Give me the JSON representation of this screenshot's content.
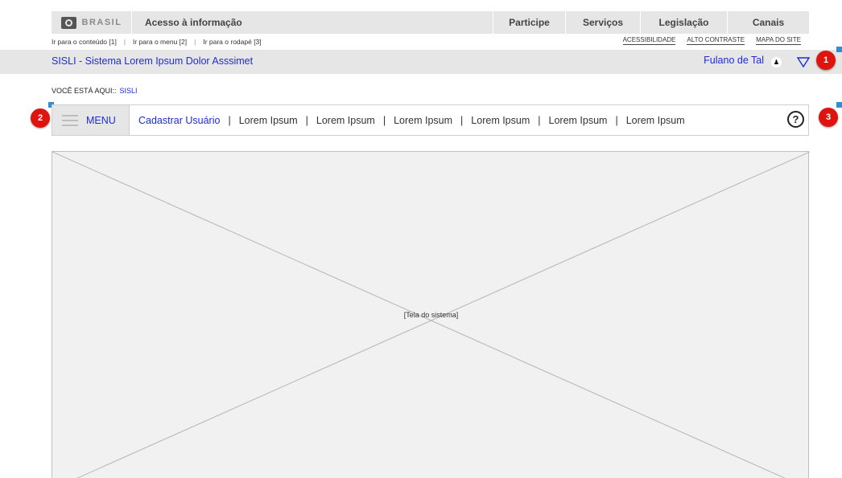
{
  "gov_bar": {
    "brand": "BRASIL",
    "access_info": "Acesso à informação",
    "nav": [
      "Participe",
      "Serviços",
      "Legislação",
      "Canais"
    ]
  },
  "shortcuts": [
    "Ir para o conteúdo [1]",
    "Ir para o menu [2]",
    "Ir para o rodapé [3]"
  ],
  "accessibility_links": [
    "ACESSIBILIDADE",
    "ALTO CONTRASTE",
    "MAPA DO SITE"
  ],
  "system_bar": {
    "title": "SISLI - Sistema Lorem Ipsum Dolor Asssimet",
    "user_name": "Fulano de Tal"
  },
  "badges": [
    "1",
    "2",
    "3"
  ],
  "breadcrumb": {
    "label": "VOCÊ ESTÁ AQUI::",
    "current": "SISLI"
  },
  "menu": {
    "label": "MENU",
    "items": [
      "Cadastrar Usuário",
      "Lorem Ipsum",
      "Lorem Ipsum",
      "Lorem Ipsum",
      "Lorem Ipsum",
      "Lorem Ipsum",
      "Lorem Ipsum"
    ],
    "separator": "|",
    "help": "?"
  },
  "content": {
    "placeholder": "[Tela do sistema]"
  },
  "colors": {
    "link": "#1f2bd6",
    "badge": "#e0140e",
    "bar": "#e6e6e6",
    "note_marker": "#2d8fd6"
  },
  "icons": [
    "brasil-logo-icon",
    "user-icon",
    "dropdown-triangle-icon",
    "hamburger-icon",
    "help-icon"
  ]
}
